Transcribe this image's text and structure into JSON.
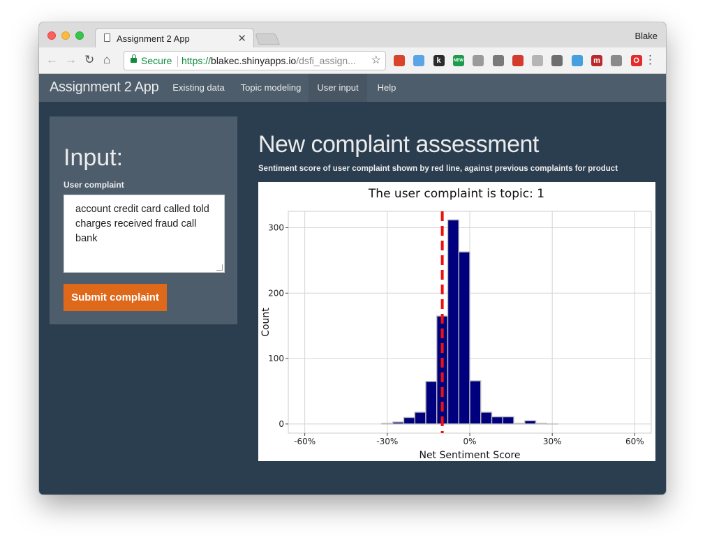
{
  "browser": {
    "tab_title": "Assignment 2 App",
    "tab_close": "✕",
    "profile_name": "Blake",
    "back": "←",
    "forward": "→",
    "reload": "↻",
    "home": "⌂",
    "secure_label": "Secure",
    "url_scheme": "https://",
    "url_host": "blakec.shinyapps.io",
    "url_path": "/dsfi_assign...",
    "bookmark_star": "☆",
    "menu": "⋮",
    "extensions": [
      {
        "name": "bookmark-extension-icon",
        "color": "#d9442b"
      },
      {
        "name": "cloud-extension-icon",
        "color": "#5aa5e6"
      },
      {
        "name": "k-extension-icon",
        "color": "#2b2b2b",
        "text": "k"
      },
      {
        "name": "new-badge-extension-icon",
        "color": "#1d9b4e",
        "text": "NEW"
      },
      {
        "name": "square-extension-icon",
        "color": "#9b9b9b"
      },
      {
        "name": "dots-extension-icon",
        "color": "#7a7a7a"
      },
      {
        "name": "red-arrow-extension-icon",
        "color": "#d33b2c"
      },
      {
        "name": "drive-extension-icon",
        "color": "#b5b5b5"
      },
      {
        "name": "lightbulb-extension-icon",
        "color": "#6e6e6e"
      },
      {
        "name": "rainbow-extension-icon",
        "color": "#45a0e0"
      },
      {
        "name": "m-extension-icon",
        "color": "#b82a2a",
        "text": "m"
      },
      {
        "name": "satellite-extension-icon",
        "color": "#8a8a8a"
      },
      {
        "name": "opera-extension-icon",
        "color": "#e42a2a",
        "text": "O"
      }
    ]
  },
  "navbar": {
    "brand": "Assignment 2 App",
    "links": [
      "Existing data",
      "Topic modeling",
      "User input",
      "Help"
    ],
    "active": "User input"
  },
  "sidebar": {
    "heading": "Input:",
    "field_label": "User complaint",
    "textarea_value": "account credit card called told charges received fraud call bank",
    "submit_label": "Submit complaint"
  },
  "main": {
    "title": "New complaint assessment",
    "subtitle": "Sentiment score of user complaint shown by red line, against previous complaints for product"
  },
  "colors": {
    "page_bg": "#2b3e50",
    "panel_bg": "#4e5d6c",
    "accent_orange": "#df691a",
    "bar_fill": "#00007f",
    "bar_outline": "#bebebe",
    "vline": "#ee1111"
  },
  "chart_data": {
    "type": "bar",
    "title": "The user complaint is topic: 1",
    "xlabel": "Net Sentiment Score",
    "ylabel": "Count",
    "xlim": [
      -0.66,
      0.66
    ],
    "ylim": [
      -14,
      325
    ],
    "xticks": [
      -0.6,
      -0.3,
      0,
      0.3,
      0.6
    ],
    "xtick_labels": [
      "-60%",
      "-30%",
      "0%",
      "30%",
      "60%"
    ],
    "yticks": [
      0,
      100,
      200,
      300
    ],
    "ytick_labels": [
      "0",
      "100",
      "200",
      "300"
    ],
    "bin_width": 0.04,
    "bin_centers": [
      -0.3,
      -0.26,
      -0.22,
      -0.18,
      -0.14,
      -0.1,
      -0.06,
      -0.02,
      0.02,
      0.06,
      0.1,
      0.14,
      0.18,
      0.22,
      0.26,
      0.3
    ],
    "counts": [
      1,
      3,
      10,
      18,
      65,
      165,
      312,
      263,
      66,
      18,
      11,
      11,
      1,
      5,
      1,
      0
    ],
    "vline_x": -0.1,
    "grid": true
  }
}
